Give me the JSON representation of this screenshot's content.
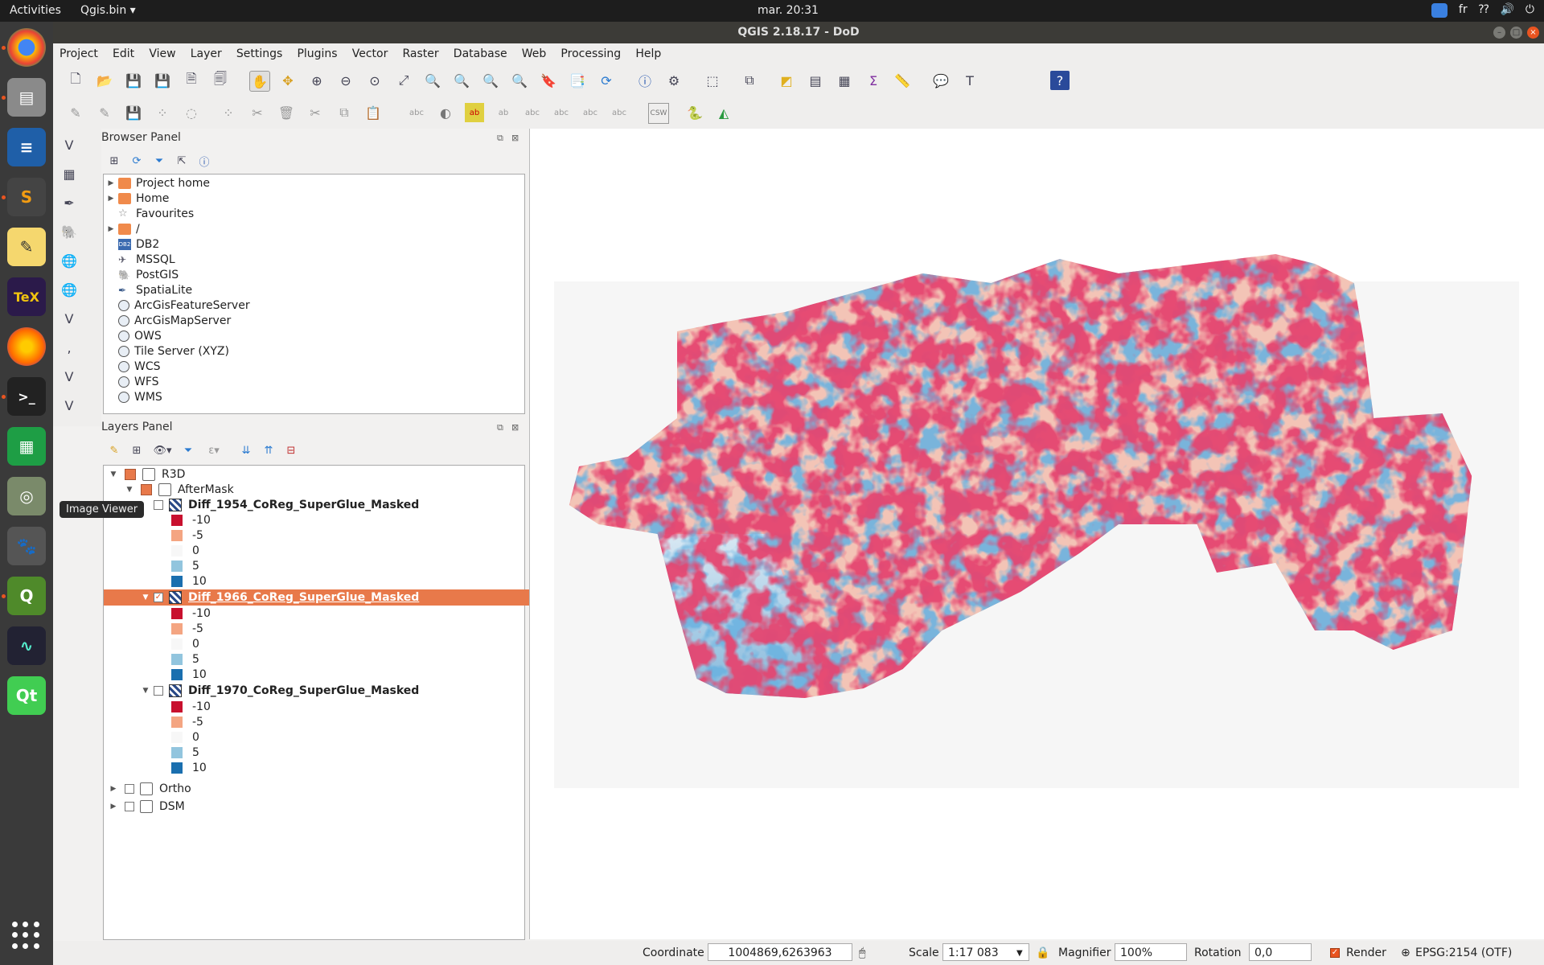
{
  "topbar": {
    "activities": "Activities",
    "app_menu": "Qgis.bin ▾",
    "clock": "mar. 20:31",
    "keyboard_layout": "fr"
  },
  "window": {
    "title": "QGIS 2.18.17 - DoD"
  },
  "menu": [
    "Project",
    "Edit",
    "View",
    "Layer",
    "Settings",
    "Plugins",
    "Vector",
    "Raster",
    "Database",
    "Web",
    "Processing",
    "Help"
  ],
  "tooltip": "Image Viewer",
  "browser_panel": {
    "title": "Browser Panel",
    "items": [
      {
        "label": "Project home",
        "icon": "folder-icon",
        "expandable": true
      },
      {
        "label": "Home",
        "icon": "folder-icon",
        "expandable": true
      },
      {
        "label": "Favourites",
        "icon": "star-icon",
        "expandable": false
      },
      {
        "label": "/",
        "icon": "folder-icon",
        "expandable": true
      },
      {
        "label": "DB2",
        "icon": "db2-icon",
        "expandable": false
      },
      {
        "label": "MSSQL",
        "icon": "mssql-icon",
        "expandable": false
      },
      {
        "label": "PostGIS",
        "icon": "postgis-icon",
        "expandable": false
      },
      {
        "label": "SpatiaLite",
        "icon": "spatialite-icon",
        "expandable": false
      },
      {
        "label": "ArcGisFeatureServer",
        "icon": "globe-icon",
        "expandable": false
      },
      {
        "label": "ArcGisMapServer",
        "icon": "globe-icon",
        "expandable": false
      },
      {
        "label": "OWS",
        "icon": "globe-icon",
        "expandable": false
      },
      {
        "label": "Tile Server (XYZ)",
        "icon": "globe-icon",
        "expandable": false
      },
      {
        "label": "WCS",
        "icon": "globe-icon",
        "expandable": false
      },
      {
        "label": "WFS",
        "icon": "globe-icon",
        "expandable": false
      },
      {
        "label": "WMS",
        "icon": "globe-icon",
        "expandable": false
      }
    ]
  },
  "layers_panel": {
    "title": "Layers Panel",
    "group_r3d": "R3D",
    "group_aftermask": "AfterMask",
    "layers": [
      {
        "name": "Diff_1954_CoReg_SuperGlue_Masked",
        "checked": false,
        "selected": false
      },
      {
        "name": "Diff_1966_CoReg_SuperGlue_Masked",
        "checked": true,
        "selected": true
      },
      {
        "name": "Diff_1970_CoReg_SuperGlue_Masked",
        "checked": false,
        "selected": false
      }
    ],
    "legend": [
      {
        "label": "-10",
        "color": "#c8102e"
      },
      {
        "label": "-5",
        "color": "#f4a582"
      },
      {
        "label": "0",
        "color": "#f7f7f7"
      },
      {
        "label": "5",
        "color": "#92c5de"
      },
      {
        "label": "10",
        "color": "#1a6faf"
      }
    ],
    "group_ortho": "Ortho",
    "group_dsm": "DSM"
  },
  "statusbar": {
    "coordinate_label": "Coordinate",
    "coordinate_value": "1004869,6263963",
    "scale_label": "Scale",
    "scale_value": "1:17 083",
    "magnifier_label": "Magnifier",
    "magnifier_value": "100%",
    "rotation_label": "Rotation",
    "rotation_value": "0,0",
    "render_label": "Render",
    "crs": "EPSG:2154 (OTF)"
  },
  "colors": {
    "accent": "#e95420",
    "selection": "#e8794a",
    "dock": "#3a3a3a"
  }
}
